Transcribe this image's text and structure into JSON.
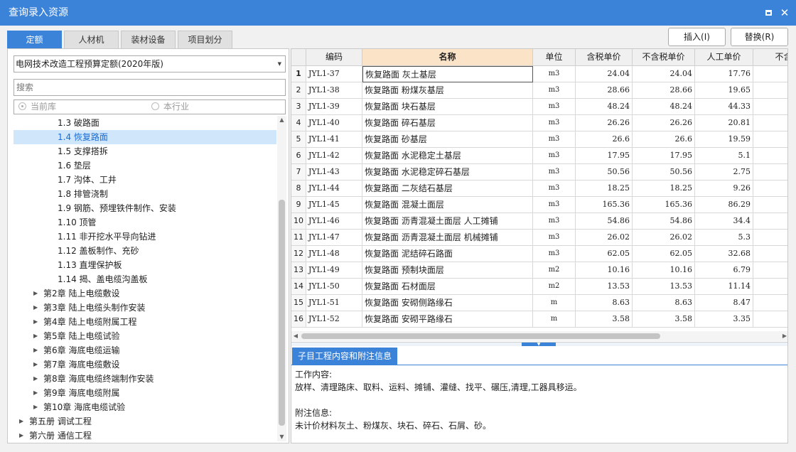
{
  "window": {
    "title": "查询录入资源"
  },
  "tabs": [
    "定额",
    "人材机",
    "装材设备",
    "项目划分"
  ],
  "actions": {
    "insert_label": "插入(I)",
    "replace_label": "替换(R)"
  },
  "left": {
    "quota_select": "电网技术改造工程预算定额(2020年版)",
    "search_placeholder": "搜索",
    "radio_current": "当前库",
    "radio_industry": "本行业"
  },
  "tree": [
    {
      "label": "1.3 破路面",
      "level": 3,
      "expander": false
    },
    {
      "label": "1.4 恢复路面",
      "level": 3,
      "expander": false,
      "selected": true
    },
    {
      "label": "1.5 支撑搭拆",
      "level": 3,
      "expander": false
    },
    {
      "label": "1.6 垫层",
      "level": 3,
      "expander": false
    },
    {
      "label": "1.7 沟体、工井",
      "level": 3,
      "expander": false
    },
    {
      "label": "1.8 排管浇制",
      "level": 3,
      "expander": false
    },
    {
      "label": "1.9 钢筋、预埋铁件制作、安装",
      "level": 3,
      "expander": false
    },
    {
      "label": "1.10 顶管",
      "level": 3,
      "expander": false
    },
    {
      "label": "1.11 非开挖水平导向钻进",
      "level": 3,
      "expander": false
    },
    {
      "label": "1.12 盖板制作、充砂",
      "level": 3,
      "expander": false
    },
    {
      "label": "1.13 直埋保护板",
      "level": 3,
      "expander": false
    },
    {
      "label": "1.14 揭、盖电缆沟盖板",
      "level": 3,
      "expander": false
    },
    {
      "label": "第2章 陆上电缆敷设",
      "level": 2,
      "expander": true
    },
    {
      "label": "第3章 陆上电缆头制作安装",
      "level": 2,
      "expander": true
    },
    {
      "label": "第4章 陆上电缆附属工程",
      "level": 2,
      "expander": true
    },
    {
      "label": "第5章 陆上电缆试验",
      "level": 2,
      "expander": true
    },
    {
      "label": "第6章 海底电缆运输",
      "level": 2,
      "expander": true
    },
    {
      "label": "第7章 海底电缆敷设",
      "level": 2,
      "expander": true
    },
    {
      "label": "第8章 海底电缆终端制作安装",
      "level": 2,
      "expander": true
    },
    {
      "label": "第9章 海底电缆附属",
      "level": 2,
      "expander": true
    },
    {
      "label": "第10章 海底电缆试验",
      "level": 2,
      "expander": true
    },
    {
      "label": "第五册 调试工程",
      "level": 1,
      "expander": true
    },
    {
      "label": "第六册 通信工程",
      "level": 1,
      "expander": true
    }
  ],
  "table": {
    "columns": [
      "",
      "编码",
      "名称",
      "单位",
      "含税单价",
      "不含税单价",
      "人工单价",
      "不含税材"
    ],
    "rows": [
      [
        "1",
        "JYL1-37",
        "恢复路面 灰土基层",
        "m3",
        "24.04",
        "24.04",
        "17.76"
      ],
      [
        "2",
        "JYL1-38",
        "恢复路面 粉煤灰基层",
        "m3",
        "28.66",
        "28.66",
        "19.65"
      ],
      [
        "3",
        "JYL1-39",
        "恢复路面 块石基层",
        "m3",
        "48.24",
        "48.24",
        "44.33"
      ],
      [
        "4",
        "JYL1-40",
        "恢复路面 碎石基层",
        "m3",
        "26.26",
        "26.26",
        "20.81"
      ],
      [
        "5",
        "JYL1-41",
        "恢复路面 砂基层",
        "m3",
        "26.6",
        "26.6",
        "19.59"
      ],
      [
        "6",
        "JYL1-42",
        "恢复路面 水泥稳定土基层",
        "m3",
        "17.95",
        "17.95",
        "5.1"
      ],
      [
        "7",
        "JYL1-43",
        "恢复路面 水泥稳定碎石基层",
        "m3",
        "50.56",
        "50.56",
        "2.75"
      ],
      [
        "8",
        "JYL1-44",
        "恢复路面 二灰结石基层",
        "m3",
        "18.25",
        "18.25",
        "9.26"
      ],
      [
        "9",
        "JYL1-45",
        "恢复路面 混凝土面层",
        "m3",
        "165.36",
        "165.36",
        "86.29"
      ],
      [
        "10",
        "JYL1-46",
        "恢复路面 沥青混凝土面层 人工摊铺",
        "m3",
        "54.86",
        "54.86",
        "34.4"
      ],
      [
        "11",
        "JYL1-47",
        "恢复路面 沥青混凝土面层 机械摊铺",
        "m3",
        "26.02",
        "26.02",
        "5.3"
      ],
      [
        "12",
        "JYL1-48",
        "恢复路面 泥结碎石路面",
        "m3",
        "62.05",
        "62.05",
        "32.68"
      ],
      [
        "13",
        "JYL1-49",
        "恢复路面 预制块面层",
        "m2",
        "10.16",
        "10.16",
        "6.79"
      ],
      [
        "14",
        "JYL1-50",
        "恢复路面 石材面层",
        "m2",
        "13.53",
        "13.53",
        "11.14"
      ],
      [
        "15",
        "JYL1-51",
        "恢复路面 安砌侧路缘石",
        "m",
        "8.63",
        "8.63",
        "8.47"
      ],
      [
        "16",
        "JYL1-52",
        "恢复路面 安砌平路缘石",
        "m",
        "3.58",
        "3.58",
        "3.35"
      ]
    ]
  },
  "info": {
    "tab_label": "子目工程内容和附注信息",
    "work_title": "工作内容:",
    "work_text": "放样、清理路床、取料、运料、摊铺、灌缝、找平、碾压,清理,工器具移运。",
    "note_title": "附注信息:",
    "note_text": "未计价材料灰土、粉煤灰、块石、碎石、石屑、砂。"
  },
  "colors": {
    "accent": "#3b83d8",
    "header_highlight": "#fbe3c8",
    "tree_selected": "#cfe6fb"
  }
}
